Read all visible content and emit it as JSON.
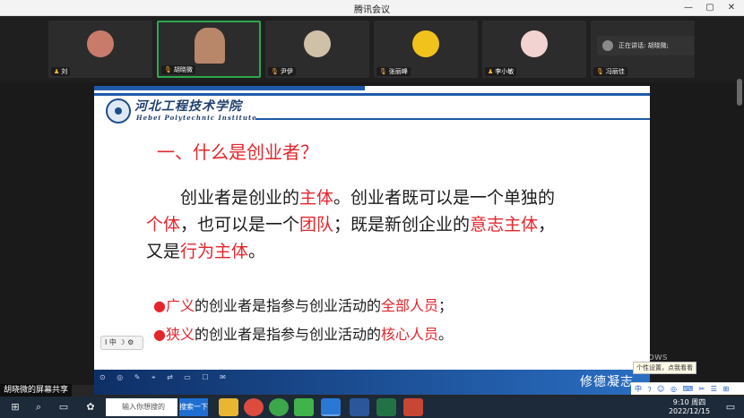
{
  "window": {
    "title": "腾讯会议",
    "buttons": [
      "—",
      "▢",
      "✕"
    ]
  },
  "participants": [
    {
      "name": "刘",
      "avatar_color": "#c97b6b",
      "active": false
    },
    {
      "name": "胡晓微",
      "avatar_color": "#b8876a",
      "active": true
    },
    {
      "name": "尹伊",
      "avatar_color": "#cfc1a8",
      "active": false
    },
    {
      "name": "张丽峰",
      "avatar_color": "#f1c21b",
      "active": false
    },
    {
      "name": "李小敏",
      "avatar_color": "#f3d2d2",
      "active": false
    },
    {
      "name": "冯丽佳",
      "avatar_color": "#3a3a3a",
      "active": false
    }
  ],
  "speaking": {
    "label": "正在讲话: 胡晓微;"
  },
  "slide": {
    "school_cn": "河北工程技术学院",
    "school_en": "Hebei Polytechnic Institute",
    "heading": "一、什么是创业者？",
    "para": [
      {
        "text": "创业者是创业的",
        "red": false
      },
      {
        "text": "主体",
        "red": true
      },
      {
        "text": "。创业者既可以是一个单独的",
        "red": false
      },
      {
        "text": "个体",
        "red": true
      },
      {
        "text": "，也可以是一个",
        "red": false
      },
      {
        "text": "团队",
        "red": true
      },
      {
        "text": "；既是新创企业的",
        "red": false
      },
      {
        "text": "意志主体",
        "red": true
      },
      {
        "text": "，又是",
        "red": false
      },
      {
        "text": "行为主体",
        "red": true
      },
      {
        "text": "。",
        "red": false
      }
    ],
    "bullets": [
      {
        "term": "广义",
        "mid": "的创业者是指参与创业活动的",
        "key": "全部人员",
        "end": "；"
      },
      {
        "term": "狭义",
        "mid": "的创业者是指参与创业活动的",
        "key": "核心人员",
        "end": "。"
      }
    ],
    "motto": "修德凝志"
  },
  "overlay": {
    "float_toolbar": "I 中 ☽ ⚙",
    "bottom_toolbar": "⊙ ◎ ✎ ⌖ ⇄ ▭ ☐ ✉",
    "activate_line1": "激活 Windows",
    "activate_line2": "转到\"设置\"以激活 Windows。",
    "share_label": "胡晓微的屏幕共享",
    "ime_tip": "个性设置，点我看看",
    "ime_bar": "中 ⁊ ☺ ◎ ⌨ ✂ ☰ ⊞"
  },
  "taskbar": {
    "search_placeholder": "输入你想搜的",
    "search_button": "搜索一下",
    "time": "9:10 周四",
    "date": "2022/12/15"
  }
}
